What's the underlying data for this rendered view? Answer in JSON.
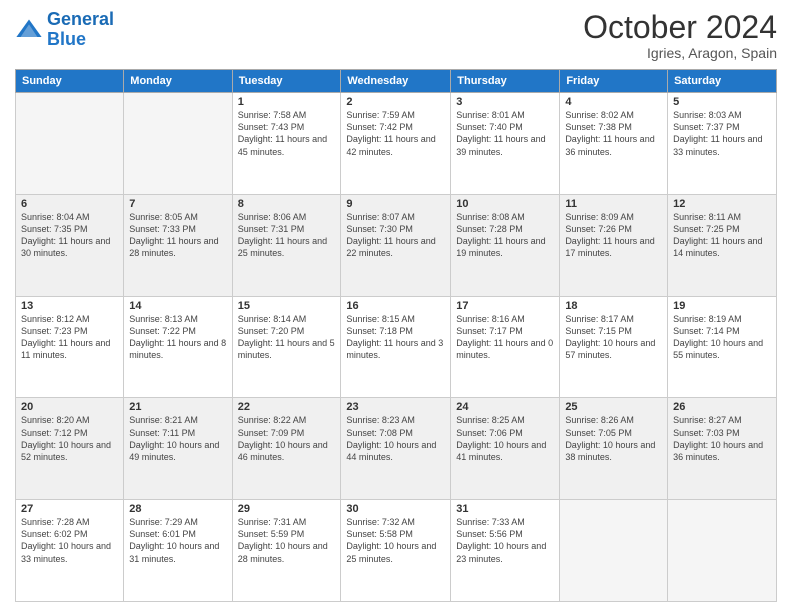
{
  "logo": {
    "line1": "General",
    "line2": "Blue"
  },
  "title": "October 2024",
  "location": "Igries, Aragon, Spain",
  "days_of_week": [
    "Sunday",
    "Monday",
    "Tuesday",
    "Wednesday",
    "Thursday",
    "Friday",
    "Saturday"
  ],
  "weeks": [
    [
      {
        "day": "",
        "sunrise": "",
        "sunset": "",
        "daylight": ""
      },
      {
        "day": "",
        "sunrise": "",
        "sunset": "",
        "daylight": ""
      },
      {
        "day": "1",
        "sunrise": "Sunrise: 7:58 AM",
        "sunset": "Sunset: 7:43 PM",
        "daylight": "Daylight: 11 hours and 45 minutes."
      },
      {
        "day": "2",
        "sunrise": "Sunrise: 7:59 AM",
        "sunset": "Sunset: 7:42 PM",
        "daylight": "Daylight: 11 hours and 42 minutes."
      },
      {
        "day": "3",
        "sunrise": "Sunrise: 8:01 AM",
        "sunset": "Sunset: 7:40 PM",
        "daylight": "Daylight: 11 hours and 39 minutes."
      },
      {
        "day": "4",
        "sunrise": "Sunrise: 8:02 AM",
        "sunset": "Sunset: 7:38 PM",
        "daylight": "Daylight: 11 hours and 36 minutes."
      },
      {
        "day": "5",
        "sunrise": "Sunrise: 8:03 AM",
        "sunset": "Sunset: 7:37 PM",
        "daylight": "Daylight: 11 hours and 33 minutes."
      }
    ],
    [
      {
        "day": "6",
        "sunrise": "Sunrise: 8:04 AM",
        "sunset": "Sunset: 7:35 PM",
        "daylight": "Daylight: 11 hours and 30 minutes."
      },
      {
        "day": "7",
        "sunrise": "Sunrise: 8:05 AM",
        "sunset": "Sunset: 7:33 PM",
        "daylight": "Daylight: 11 hours and 28 minutes."
      },
      {
        "day": "8",
        "sunrise": "Sunrise: 8:06 AM",
        "sunset": "Sunset: 7:31 PM",
        "daylight": "Daylight: 11 hours and 25 minutes."
      },
      {
        "day": "9",
        "sunrise": "Sunrise: 8:07 AM",
        "sunset": "Sunset: 7:30 PM",
        "daylight": "Daylight: 11 hours and 22 minutes."
      },
      {
        "day": "10",
        "sunrise": "Sunrise: 8:08 AM",
        "sunset": "Sunset: 7:28 PM",
        "daylight": "Daylight: 11 hours and 19 minutes."
      },
      {
        "day": "11",
        "sunrise": "Sunrise: 8:09 AM",
        "sunset": "Sunset: 7:26 PM",
        "daylight": "Daylight: 11 hours and 17 minutes."
      },
      {
        "day": "12",
        "sunrise": "Sunrise: 8:11 AM",
        "sunset": "Sunset: 7:25 PM",
        "daylight": "Daylight: 11 hours and 14 minutes."
      }
    ],
    [
      {
        "day": "13",
        "sunrise": "Sunrise: 8:12 AM",
        "sunset": "Sunset: 7:23 PM",
        "daylight": "Daylight: 11 hours and 11 minutes."
      },
      {
        "day": "14",
        "sunrise": "Sunrise: 8:13 AM",
        "sunset": "Sunset: 7:22 PM",
        "daylight": "Daylight: 11 hours and 8 minutes."
      },
      {
        "day": "15",
        "sunrise": "Sunrise: 8:14 AM",
        "sunset": "Sunset: 7:20 PM",
        "daylight": "Daylight: 11 hours and 5 minutes."
      },
      {
        "day": "16",
        "sunrise": "Sunrise: 8:15 AM",
        "sunset": "Sunset: 7:18 PM",
        "daylight": "Daylight: 11 hours and 3 minutes."
      },
      {
        "day": "17",
        "sunrise": "Sunrise: 8:16 AM",
        "sunset": "Sunset: 7:17 PM",
        "daylight": "Daylight: 11 hours and 0 minutes."
      },
      {
        "day": "18",
        "sunrise": "Sunrise: 8:17 AM",
        "sunset": "Sunset: 7:15 PM",
        "daylight": "Daylight: 10 hours and 57 minutes."
      },
      {
        "day": "19",
        "sunrise": "Sunrise: 8:19 AM",
        "sunset": "Sunset: 7:14 PM",
        "daylight": "Daylight: 10 hours and 55 minutes."
      }
    ],
    [
      {
        "day": "20",
        "sunrise": "Sunrise: 8:20 AM",
        "sunset": "Sunset: 7:12 PM",
        "daylight": "Daylight: 10 hours and 52 minutes."
      },
      {
        "day": "21",
        "sunrise": "Sunrise: 8:21 AM",
        "sunset": "Sunset: 7:11 PM",
        "daylight": "Daylight: 10 hours and 49 minutes."
      },
      {
        "day": "22",
        "sunrise": "Sunrise: 8:22 AM",
        "sunset": "Sunset: 7:09 PM",
        "daylight": "Daylight: 10 hours and 46 minutes."
      },
      {
        "day": "23",
        "sunrise": "Sunrise: 8:23 AM",
        "sunset": "Sunset: 7:08 PM",
        "daylight": "Daylight: 10 hours and 44 minutes."
      },
      {
        "day": "24",
        "sunrise": "Sunrise: 8:25 AM",
        "sunset": "Sunset: 7:06 PM",
        "daylight": "Daylight: 10 hours and 41 minutes."
      },
      {
        "day": "25",
        "sunrise": "Sunrise: 8:26 AM",
        "sunset": "Sunset: 7:05 PM",
        "daylight": "Daylight: 10 hours and 38 minutes."
      },
      {
        "day": "26",
        "sunrise": "Sunrise: 8:27 AM",
        "sunset": "Sunset: 7:03 PM",
        "daylight": "Daylight: 10 hours and 36 minutes."
      }
    ],
    [
      {
        "day": "27",
        "sunrise": "Sunrise: 7:28 AM",
        "sunset": "Sunset: 6:02 PM",
        "daylight": "Daylight: 10 hours and 33 minutes."
      },
      {
        "day": "28",
        "sunrise": "Sunrise: 7:29 AM",
        "sunset": "Sunset: 6:01 PM",
        "daylight": "Daylight: 10 hours and 31 minutes."
      },
      {
        "day": "29",
        "sunrise": "Sunrise: 7:31 AM",
        "sunset": "Sunset: 5:59 PM",
        "daylight": "Daylight: 10 hours and 28 minutes."
      },
      {
        "day": "30",
        "sunrise": "Sunrise: 7:32 AM",
        "sunset": "Sunset: 5:58 PM",
        "daylight": "Daylight: 10 hours and 25 minutes."
      },
      {
        "day": "31",
        "sunrise": "Sunrise: 7:33 AM",
        "sunset": "Sunset: 5:56 PM",
        "daylight": "Daylight: 10 hours and 23 minutes."
      },
      {
        "day": "",
        "sunrise": "",
        "sunset": "",
        "daylight": ""
      },
      {
        "day": "",
        "sunrise": "",
        "sunset": "",
        "daylight": ""
      }
    ]
  ]
}
